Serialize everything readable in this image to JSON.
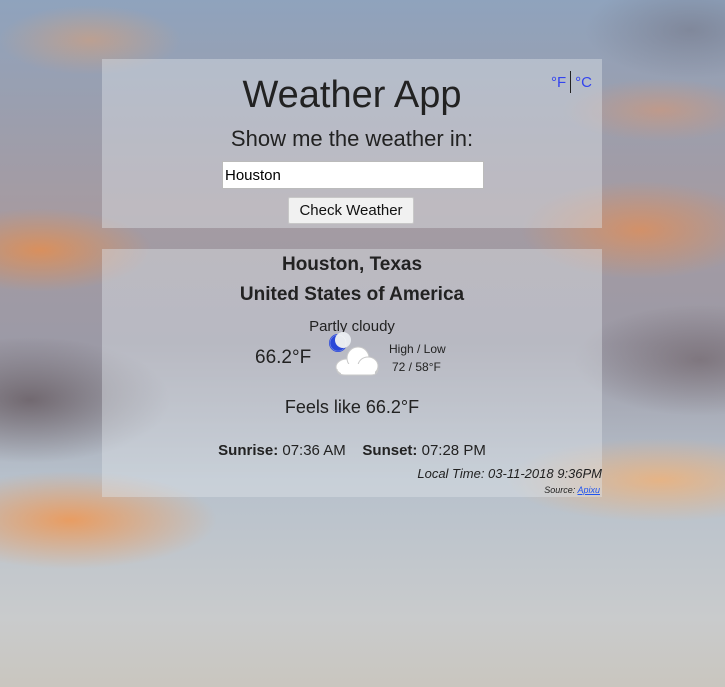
{
  "units": {
    "fahrenheit": "°F",
    "celsius": "°C"
  },
  "header": {
    "title": "Weather App",
    "prompt": "Show me the weather in:"
  },
  "search": {
    "value": "Houston",
    "button_label": "Check Weather"
  },
  "result": {
    "city": "Houston, Texas",
    "country": "United States of America",
    "condition": "Partly cloudy",
    "temperature": "66.2°F",
    "icon": "partly-cloudy-night-icon",
    "high_low_label": "High / Low",
    "high_low_value": "72 / 58°F",
    "feels_like": "Feels like 66.2°F",
    "sunrise_label": "Sunrise:",
    "sunrise": "07:36 AM",
    "sunset_label": "Sunset:",
    "sunset": "07:28 PM",
    "local_time": "Local Time: 03-11-2018 9:36PM",
    "source_label": "Source:",
    "source_link": "Apixu"
  },
  "colors": {
    "link": "#3344ee",
    "text": "#222222"
  }
}
